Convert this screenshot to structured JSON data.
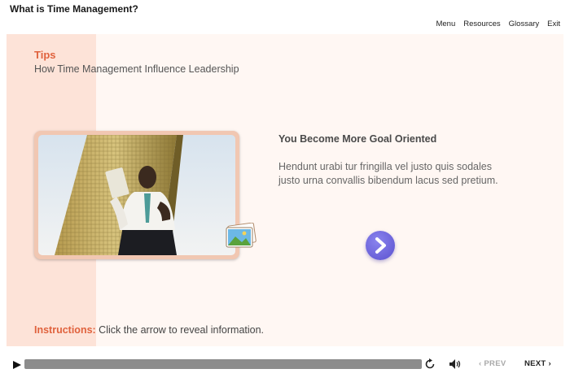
{
  "course": {
    "title": "What is Time Management?"
  },
  "nav": {
    "menu": "Menu",
    "resources": "Resources",
    "glossary": "Glossary",
    "exit": "Exit"
  },
  "slide": {
    "heading": "Tips",
    "subtitle": "How Time Management Influence Leadership",
    "point_title": "You Become More Goal Oriented",
    "point_body": "Hendunt urabi tur fringilla vel justo quis sodales justo urna convallis bibendum lacus sed pretium.",
    "instructions_label": "Instructions:",
    "instructions_text": " Click the arrow to reveal information."
  },
  "player": {
    "prev_label": "PREV",
    "next_label": "NEXT"
  },
  "icons": {
    "play": "play-icon",
    "replay": "replay-icon",
    "volume": "volume-icon",
    "arrow": "chevron-right-icon",
    "gallery": "image-gallery-icon",
    "prev": "chevron-left-icon",
    "next": "chevron-right-icon"
  },
  "colors": {
    "accent": "#e0623d",
    "arrow_button": "#6a60dc",
    "slide_bg": "#fff7f3",
    "side_band": "#fde3d8"
  }
}
